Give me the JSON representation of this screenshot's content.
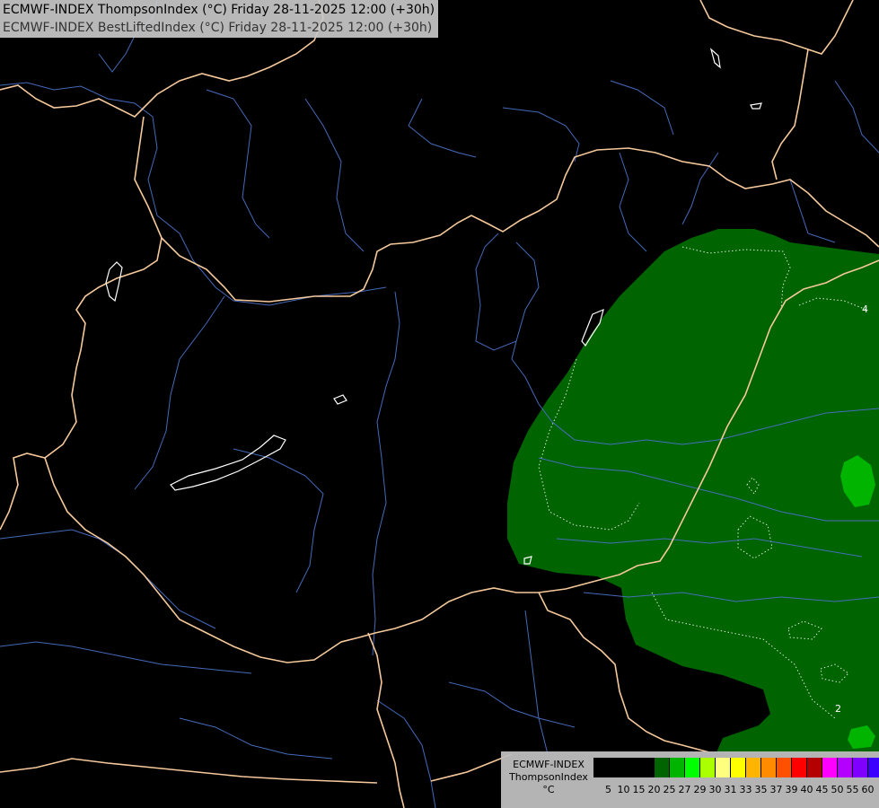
{
  "title": {
    "line1": "ECMWF-INDEX ThompsonIndex (°C) Friday 28-11-2025 12:00 (+30h)",
    "line2": "ECMWF-INDEX BestLiftedIndex (°C) Friday 28-11-2025 12:00 (+30h)"
  },
  "contour_labels": [
    "4",
    "2"
  ],
  "legend": {
    "model": "ECMWF-INDEX",
    "parameter": "ThompsonIndex",
    "unit": "°C",
    "ticks": [
      "5",
      "10",
      "15",
      "20",
      "25",
      "27",
      "29",
      "30",
      "31",
      "33",
      "35",
      "37",
      "39",
      "40",
      "45",
      "50",
      "55",
      "60"
    ],
    "colors": [
      "#000000",
      "#000000",
      "#000000",
      "#000000",
      "#006400",
      "#00b400",
      "#00ff00",
      "#aaff00",
      "#ffff7f",
      "#ffff00",
      "#ffb400",
      "#ff8c00",
      "#ff5000",
      "#ff0000",
      "#b40000",
      "#ff00ff",
      "#b400ff",
      "#7f00ff",
      "#3c00ff",
      "#0000ff"
    ]
  },
  "colors": {
    "background": "#000000",
    "borders": "#f5c99b",
    "rivers": "#4a6fc4",
    "coast": "#ffffff",
    "field_low": "#006400",
    "field_mid": "#00b400"
  }
}
